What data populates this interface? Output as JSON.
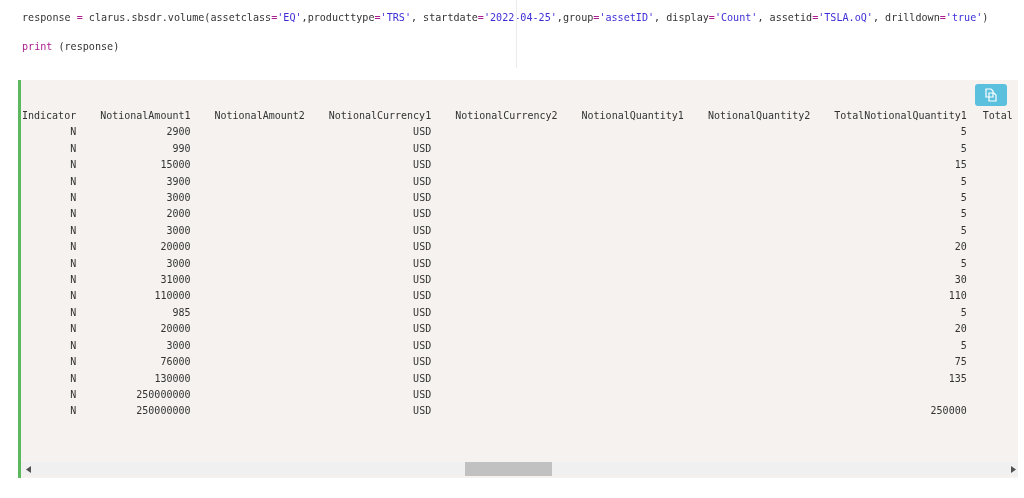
{
  "code_lines": [
    [
      {
        "kind": "text",
        "text": "response "
      },
      {
        "kind": "op",
        "text": "="
      },
      {
        "kind": "text",
        "text": " clarus.sbsdr.volume(assetclass"
      },
      {
        "kind": "op",
        "text": "="
      },
      {
        "kind": "str",
        "text": "'EQ'"
      },
      {
        "kind": "text",
        "text": ",producttype"
      },
      {
        "kind": "op",
        "text": "="
      },
      {
        "kind": "str",
        "text": "'TRS'"
      },
      {
        "kind": "text",
        "text": ", startdate"
      },
      {
        "kind": "op",
        "text": "="
      },
      {
        "kind": "str",
        "text": "'2022-04-25'"
      },
      {
        "kind": "text",
        "text": ",group"
      },
      {
        "kind": "op",
        "text": "="
      },
      {
        "kind": "str",
        "text": "'assetID'"
      },
      {
        "kind": "text",
        "text": ", display"
      },
      {
        "kind": "op",
        "text": "="
      },
      {
        "kind": "str",
        "text": "'Count'"
      },
      {
        "kind": "text",
        "text": ", assetid"
      },
      {
        "kind": "op",
        "text": "="
      },
      {
        "kind": "str",
        "text": "'TSLA.oQ'"
      },
      {
        "kind": "text",
        "text": ", drilldown"
      },
      {
        "kind": "op",
        "text": "="
      },
      {
        "kind": "str",
        "text": "'true'"
      },
      {
        "kind": "text",
        "text": ")"
      }
    ],
    [
      {
        "kind": "kw",
        "text": "print"
      },
      {
        "kind": "text",
        "text": " (response)"
      }
    ]
  ],
  "output": {
    "columns": [
      "Indicator",
      "NotionalAmount1",
      "NotionalAmount2",
      "NotionalCurrency1",
      "NotionalCurrency2",
      "NotionalQuantity1",
      "NotionalQuantity2",
      "TotalNotionalQuantity1",
      "Total"
    ],
    "rows": [
      [
        "N",
        "2900",
        "",
        "USD",
        "",
        "",
        "",
        "5"
      ],
      [
        "N",
        "990",
        "",
        "USD",
        "",
        "",
        "",
        "5"
      ],
      [
        "N",
        "15000",
        "",
        "USD",
        "",
        "",
        "",
        "15"
      ],
      [
        "N",
        "3900",
        "",
        "USD",
        "",
        "",
        "",
        "5"
      ],
      [
        "N",
        "3000",
        "",
        "USD",
        "",
        "",
        "",
        "5"
      ],
      [
        "N",
        "2000",
        "",
        "USD",
        "",
        "",
        "",
        "5"
      ],
      [
        "N",
        "3000",
        "",
        "USD",
        "",
        "",
        "",
        "5"
      ],
      [
        "N",
        "20000",
        "",
        "USD",
        "",
        "",
        "",
        "20"
      ],
      [
        "N",
        "3000",
        "",
        "USD",
        "",
        "",
        "",
        "5"
      ],
      [
        "N",
        "31000",
        "",
        "USD",
        "",
        "",
        "",
        "30"
      ],
      [
        "N",
        "110000",
        "",
        "USD",
        "",
        "",
        "",
        "110"
      ],
      [
        "N",
        "985",
        "",
        "USD",
        "",
        "",
        "",
        "5"
      ],
      [
        "N",
        "20000",
        "",
        "USD",
        "",
        "",
        "",
        "20"
      ],
      [
        "N",
        "3000",
        "",
        "USD",
        "",
        "",
        "",
        "5"
      ],
      [
        "N",
        "76000",
        "",
        "USD",
        "",
        "",
        "",
        "75"
      ],
      [
        "N",
        "130000",
        "",
        "USD",
        "",
        "",
        "",
        "135"
      ],
      [
        "N",
        "250000000",
        "",
        "USD",
        "",
        "",
        "",
        ""
      ],
      [
        "N",
        "250000000",
        "",
        "USD",
        "",
        "",
        "",
        "250000"
      ]
    ]
  }
}
